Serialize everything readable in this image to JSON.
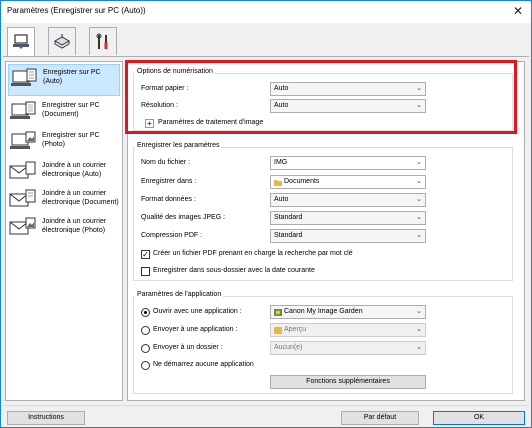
{
  "window": {
    "title": "Paramètres (Enregistrer sur PC (Auto))",
    "close_glyph": "✕"
  },
  "tabs": [
    {
      "icon": "scan-to-pc-icon"
    },
    {
      "icon": "scanner-icon"
    },
    {
      "icon": "tools-icon"
    }
  ],
  "sidebar": {
    "items": [
      {
        "label": "Enregistrer sur PC (Auto)",
        "icon": "save-to-pc-auto-icon",
        "selected": true
      },
      {
        "label": "Enregistrer sur PC (Document)",
        "icon": "save-to-pc-document-icon"
      },
      {
        "label": "Enregistrer sur PC (Photo)",
        "icon": "save-to-pc-photo-icon"
      },
      {
        "label": "Joindre à un courrier électronique (Auto)",
        "icon": "email-auto-icon"
      },
      {
        "label": "Joindre à un courrier électronique (Document)",
        "icon": "email-document-icon"
      },
      {
        "label": "Joindre à un courrier électronique (Photo)",
        "icon": "email-photo-icon"
      }
    ]
  },
  "scan_options": {
    "title": "Options de numérisation",
    "paper_size_label": "Format papier :",
    "paper_size_value": "Auto",
    "resolution_label": "Résolution :",
    "resolution_value": "Auto",
    "image_processing_label": "Paramètres de traitement d'image",
    "expand_glyph": "+"
  },
  "save_settings": {
    "title": "Enregistrer les paramètres",
    "filename_label": "Nom du fichier :",
    "filename_value": "IMG",
    "save_in_label": "Enregistrer dans :",
    "save_in_value": "Documents",
    "data_format_label": "Format données :",
    "data_format_value": "Auto",
    "jpeg_quality_label": "Qualité des images JPEG :",
    "jpeg_quality_value": "Standard",
    "pdf_compression_label": "Compression PDF :",
    "pdf_compression_value": "Standard",
    "searchable_pdf_label": "Créer un fichier PDF prenant en charge la recherche par mot clé",
    "searchable_pdf_checked": true,
    "subfolder_label": "Enregistrer dans sous-dossier avec la date courante",
    "subfolder_checked": false,
    "check_glyph": "✓"
  },
  "app_settings": {
    "title": "Paramètres de l'application",
    "open_with_label": "Ouvrir avec une application :",
    "open_with_value": "Canon My Image Garden",
    "send_to_app_label": "Envoyer à une application :",
    "send_to_app_value": "Aperçu",
    "send_to_folder_label": "Envoyer à un dossier :",
    "send_to_folder_value": "Aucun(e)",
    "no_app_label": "Ne démarrez aucune application",
    "more_functions_label": "Fonctions supplémentaires"
  },
  "footer": {
    "instructions_label": "Instructions",
    "defaults_label": "Par défaut",
    "ok_label": "OK"
  },
  "colors": {
    "highlight": "#e4141b",
    "selection": "#cce8ff",
    "window_border": "#1883d7"
  },
  "arrow_glyph": "⌄"
}
